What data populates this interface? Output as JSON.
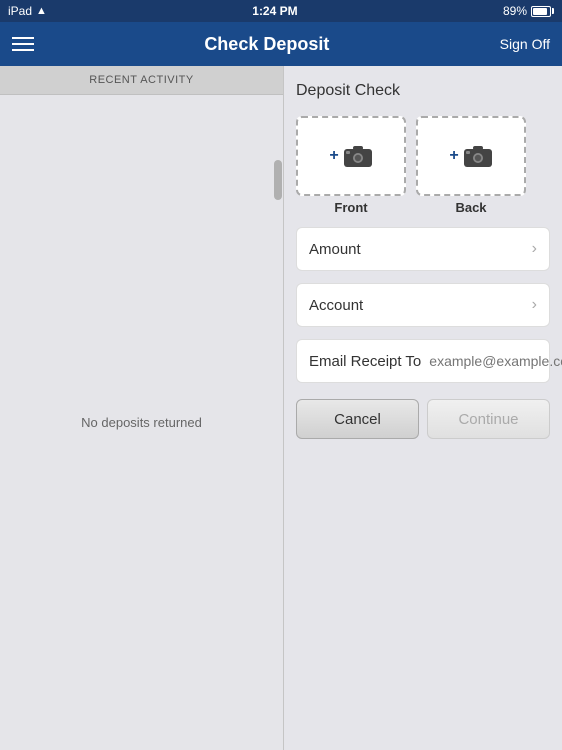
{
  "statusBar": {
    "device": "iPad",
    "time": "1:24 PM",
    "battery": "89%",
    "wifiLabel": "wifi"
  },
  "navBar": {
    "title": "Check Deposit",
    "signOff": "Sign Off",
    "menuIcon": "menu-icon"
  },
  "leftPanel": {
    "recentActivityLabel": "RECENT ACTIVITY",
    "noDeposits": "No deposits returned"
  },
  "rightPanel": {
    "depositCheckTitle": "Deposit Check",
    "front": {
      "label": "Front",
      "plusLabel": "+"
    },
    "back": {
      "label": "Back",
      "plusLabel": "+"
    },
    "amountField": {
      "label": "Amount",
      "chevron": "›"
    },
    "accountField": {
      "label": "Account",
      "chevron": "›"
    },
    "emailField": {
      "label": "Email Receipt To",
      "placeholder": "example@example.com"
    },
    "buttons": {
      "cancel": "Cancel",
      "continue": "Continue"
    }
  }
}
